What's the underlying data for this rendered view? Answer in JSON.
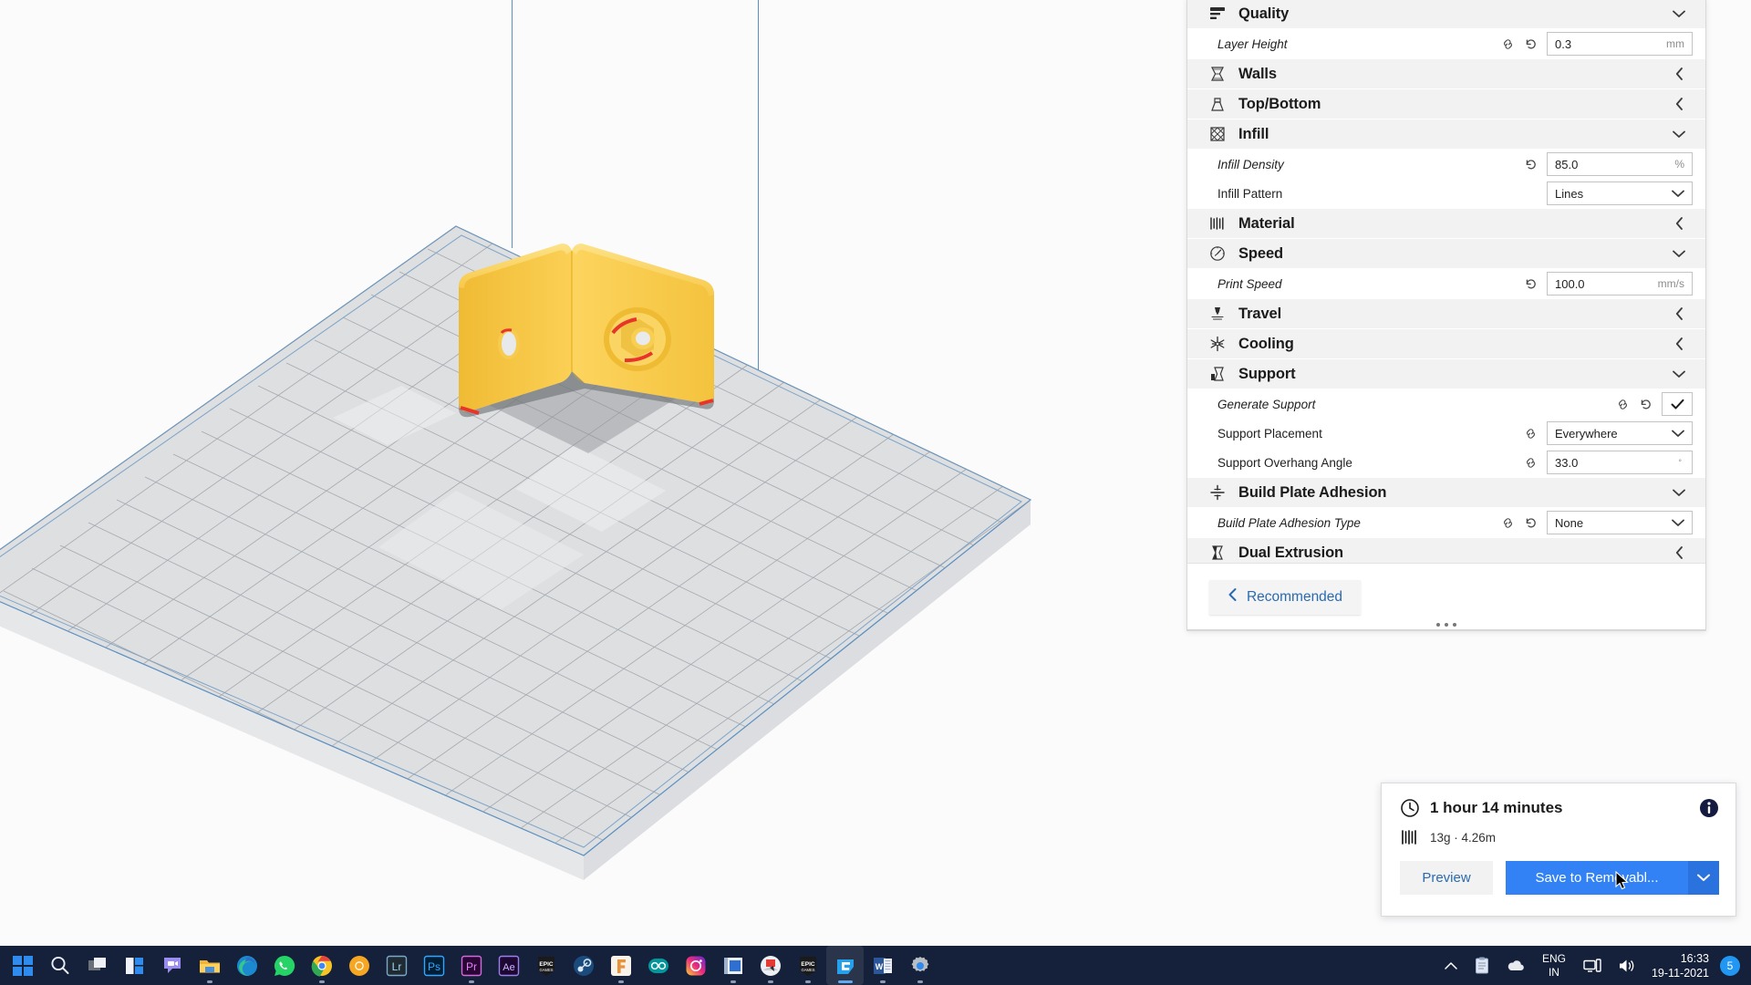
{
  "app": {
    "name": "Ultimaker Cura"
  },
  "viewport": {
    "model_name": "l-bracket-model",
    "model_color": "#f5c13b",
    "overhang_color": "#e8352a",
    "plate_color": "#d4d6d8",
    "build_volume_line_color": "#5b8fc0"
  },
  "settings_panel": {
    "categories": [
      {
        "id": "quality",
        "label": "Quality",
        "icon": "quality-icon",
        "expanded": true,
        "chevron": "chevron-down",
        "settings": [
          {
            "id": "layer_height",
            "label": "Layer Height",
            "italic": true,
            "icons": [
              "link-icon",
              "revert-icon"
            ],
            "control": "text",
            "value": "0.3",
            "unit": "mm"
          }
        ]
      },
      {
        "id": "walls",
        "label": "Walls",
        "icon": "walls-icon",
        "expanded": false,
        "chevron": "chevron-left",
        "settings": []
      },
      {
        "id": "top_bottom",
        "label": "Top/Bottom",
        "icon": "top-bottom-icon",
        "expanded": false,
        "chevron": "chevron-left",
        "settings": []
      },
      {
        "id": "infill",
        "label": "Infill",
        "icon": "infill-icon",
        "expanded": true,
        "chevron": "chevron-down",
        "settings": [
          {
            "id": "infill_density",
            "label": "Infill Density",
            "italic": true,
            "icons": [
              "revert-icon"
            ],
            "control": "text",
            "value": "85.0",
            "unit": "%"
          },
          {
            "id": "infill_pattern",
            "label": "Infill Pattern",
            "italic": false,
            "icons": [],
            "control": "select",
            "value": "Lines",
            "unit": ""
          }
        ]
      },
      {
        "id": "material",
        "label": "Material",
        "icon": "material-icon",
        "expanded": false,
        "chevron": "chevron-left",
        "settings": []
      },
      {
        "id": "speed",
        "label": "Speed",
        "icon": "speed-icon",
        "expanded": true,
        "chevron": "chevron-down",
        "settings": [
          {
            "id": "print_speed",
            "label": "Print Speed",
            "italic": true,
            "icons": [
              "revert-icon"
            ],
            "control": "text",
            "value": "100.0",
            "unit": "mm/s"
          }
        ]
      },
      {
        "id": "travel",
        "label": "Travel",
        "icon": "travel-icon",
        "expanded": false,
        "chevron": "chevron-left",
        "settings": []
      },
      {
        "id": "cooling",
        "label": "Cooling",
        "icon": "cooling-icon",
        "expanded": false,
        "chevron": "chevron-left",
        "settings": []
      },
      {
        "id": "support",
        "label": "Support",
        "icon": "support-icon",
        "expanded": true,
        "chevron": "chevron-down",
        "settings": [
          {
            "id": "generate_support",
            "label": "Generate Support",
            "italic": true,
            "icons": [
              "link-icon",
              "revert-icon"
            ],
            "control": "checkbox",
            "value": "checked",
            "unit": ""
          },
          {
            "id": "support_placement",
            "label": "Support Placement",
            "italic": false,
            "icons": [
              "link-icon"
            ],
            "control": "select",
            "value": "Everywhere",
            "unit": ""
          },
          {
            "id": "support_overhang_angle",
            "label": "Support Overhang Angle",
            "italic": false,
            "icons": [
              "link-icon"
            ],
            "control": "text",
            "value": "33.0",
            "unit": "°"
          }
        ]
      },
      {
        "id": "build_plate_adhesion",
        "label": "Build Plate Adhesion",
        "icon": "adhesion-icon",
        "expanded": true,
        "chevron": "chevron-down",
        "settings": [
          {
            "id": "adhesion_type",
            "label": "Build Plate Adhesion Type",
            "italic": true,
            "icons": [
              "link-icon",
              "revert-icon"
            ],
            "control": "select",
            "value": "None",
            "unit": ""
          }
        ]
      },
      {
        "id": "dual_extrusion",
        "label": "Dual Extrusion",
        "icon": "dual-extrusion-icon",
        "expanded": false,
        "chevron": "chevron-left",
        "settings": []
      }
    ],
    "footer": {
      "recommended_label": "Recommended",
      "back_icon": "chevron-left-icon"
    }
  },
  "job_panel": {
    "time_icon": "clock-icon",
    "time": "1 hour 14 minutes",
    "info_icon": "info-icon",
    "material_icon": "material-spool-icon",
    "material": "13g · 4.26m",
    "preview_label": "Preview",
    "save_label": "Save to Removabl...",
    "dropdown_icon": "chevron-down-icon",
    "accent_color": "#3282f6"
  },
  "taskbar": {
    "items": [
      {
        "id": "start",
        "name": "start-icon",
        "running": false
      },
      {
        "id": "search",
        "name": "search-icon",
        "running": false
      },
      {
        "id": "task-view",
        "name": "task-view-icon",
        "running": false
      },
      {
        "id": "widgets",
        "name": "widgets-icon",
        "running": false
      },
      {
        "id": "teams",
        "name": "teams-chat-icon",
        "running": false
      },
      {
        "id": "explorer",
        "name": "file-explorer-icon",
        "running": true
      },
      {
        "id": "edge",
        "name": "microsoft-edge-icon",
        "running": false
      },
      {
        "id": "whatsapp",
        "name": "whatsapp-icon",
        "running": false
      },
      {
        "id": "chrome",
        "name": "google-chrome-icon",
        "running": true
      },
      {
        "id": "chromium",
        "name": "chromium-icon",
        "running": false
      },
      {
        "id": "lightroom",
        "name": "adobe-lightroom-icon",
        "running": false
      },
      {
        "id": "photoshop",
        "name": "adobe-photoshop-icon",
        "running": false
      },
      {
        "id": "premiere",
        "name": "adobe-premiere-icon",
        "running": true
      },
      {
        "id": "aftereffects",
        "name": "adobe-after-effects-icon",
        "running": false
      },
      {
        "id": "epic1",
        "name": "epic-games-icon",
        "running": false
      },
      {
        "id": "steam",
        "name": "steam-icon",
        "running": false
      },
      {
        "id": "fusion",
        "name": "fusion-360-icon",
        "running": true
      },
      {
        "id": "arduino",
        "name": "arduino-icon",
        "running": false
      },
      {
        "id": "instagram",
        "name": "instagram-icon",
        "running": false
      },
      {
        "id": "movies",
        "name": "movies-tv-icon",
        "running": true
      },
      {
        "id": "snip",
        "name": "snipping-tool-icon",
        "running": true
      },
      {
        "id": "epic2",
        "name": "epic-games-launcher-icon",
        "running": true
      },
      {
        "id": "cura",
        "name": "ultimaker-cura-icon",
        "running": true,
        "active": true
      },
      {
        "id": "word",
        "name": "microsoft-word-icon",
        "running": true
      },
      {
        "id": "settings",
        "name": "windows-settings-icon",
        "running": true
      }
    ],
    "tray": {
      "overflow_icon": "chevron-up-icon",
      "clipboard_icon": "clipboard-icon",
      "onedrive_icon": "onedrive-icon",
      "lang_line1": "ENG",
      "lang_line2": "IN",
      "network_icon": "network-icon",
      "volume_icon": "volume-icon",
      "time": "16:33",
      "date": "19-11-2021",
      "notification_count": "5"
    }
  }
}
